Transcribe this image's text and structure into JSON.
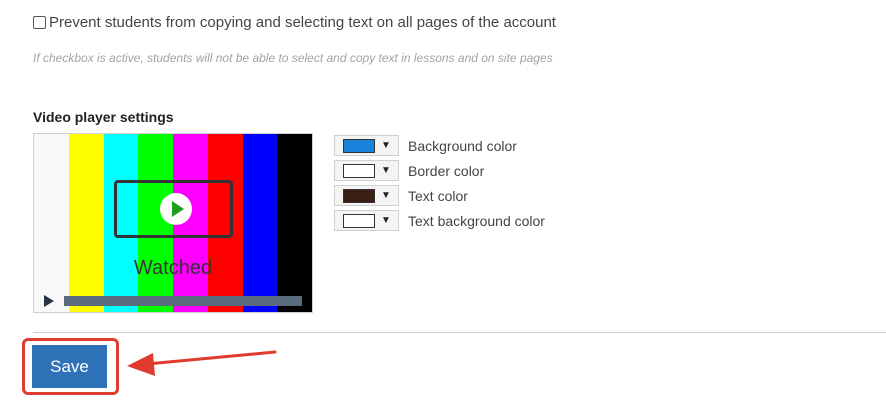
{
  "settings": {
    "prevent_copy_label": "Prevent students from copying and selecting text on all pages of the account",
    "prevent_copy_checked": false,
    "hint": "If checkbox is active, students will not be able to select and copy text in lessons and on site pages"
  },
  "video_player": {
    "title": "Video player settings",
    "preview": {
      "watched_label": "Watched",
      "bar_colors": [
        "#f8f8f8",
        "#ffff00",
        "#00ffff",
        "#00ff00",
        "#ff00ff",
        "#ff0000",
        "#0000ff",
        "#000000"
      ]
    },
    "colors": [
      {
        "label": "Background color",
        "value": "#1a84dc"
      },
      {
        "label": "Border color",
        "value": "#ffffff"
      },
      {
        "label": "Text color",
        "value": "#3a1f14"
      },
      {
        "label": "Text background color",
        "value": "#ffffff"
      }
    ]
  },
  "actions": {
    "save_label": "Save"
  }
}
